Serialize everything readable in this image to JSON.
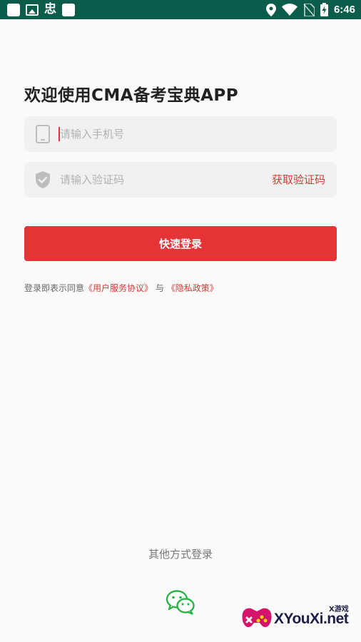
{
  "status_bar": {
    "time": "6:46",
    "left_icons": [
      "app-square-icon",
      "image-icon",
      "bug-icon",
      "app-square-icon"
    ],
    "right_icons": [
      "location-icon",
      "wifi-icon",
      "no-sim-icon",
      "battery-charging-icon"
    ]
  },
  "login": {
    "title": "欢迎使用CMA备考宝典APP",
    "phone_placeholder": "请输入手机号",
    "phone_icon": "phone-icon",
    "code_placeholder": "请输入验证码",
    "code_icon": "shield-check-icon",
    "get_code_label": "获取验证码",
    "submit_label": "快速登录",
    "agreement_prefix": "登录即表示同意",
    "user_agreement_link": "《用户服务协议》",
    "agreement_joiner": "与",
    "privacy_link": "《隐私政策》"
  },
  "other_login": {
    "label": "其他方式登录",
    "wechat_icon": "wechat-icon"
  },
  "watermark": {
    "text": "XYouXi.net",
    "tag": "X游戏"
  },
  "colors": {
    "status_bar": "#0b5c4a",
    "primary_red": "#e53435",
    "link_red": "#d63a38",
    "field_bg": "#f1f1f1",
    "wechat_green": "#2bb34a"
  }
}
